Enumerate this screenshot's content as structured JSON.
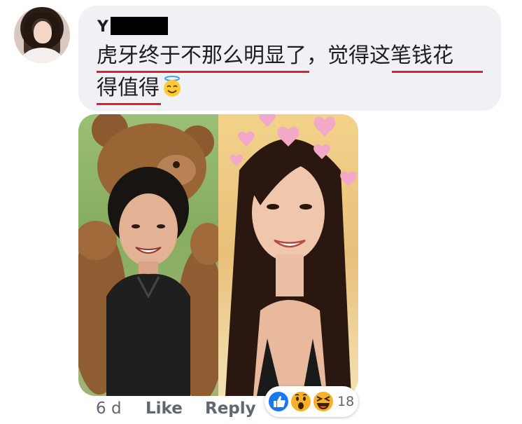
{
  "comment": {
    "author_visible": "Y",
    "line1_part1": "虎牙终于不那么明显了",
    "line1_part2": "，觉得",
    "line1_part3": "这笔钱花",
    "line2_part1": "得值得"
  },
  "actions": {
    "time": "6 d",
    "like_label": "Like",
    "reply_label": "Reply",
    "reaction_count": "18"
  },
  "colors": {
    "bubble_bg": "#f0f1f4",
    "underline": "#e0202a",
    "like_blue": "#1877f2",
    "wow_yellow": "#f7b125"
  },
  "icons": [
    "angel-emoji-icon",
    "like-reaction-icon",
    "wow-reaction-icon",
    "haha-reaction-icon"
  ]
}
